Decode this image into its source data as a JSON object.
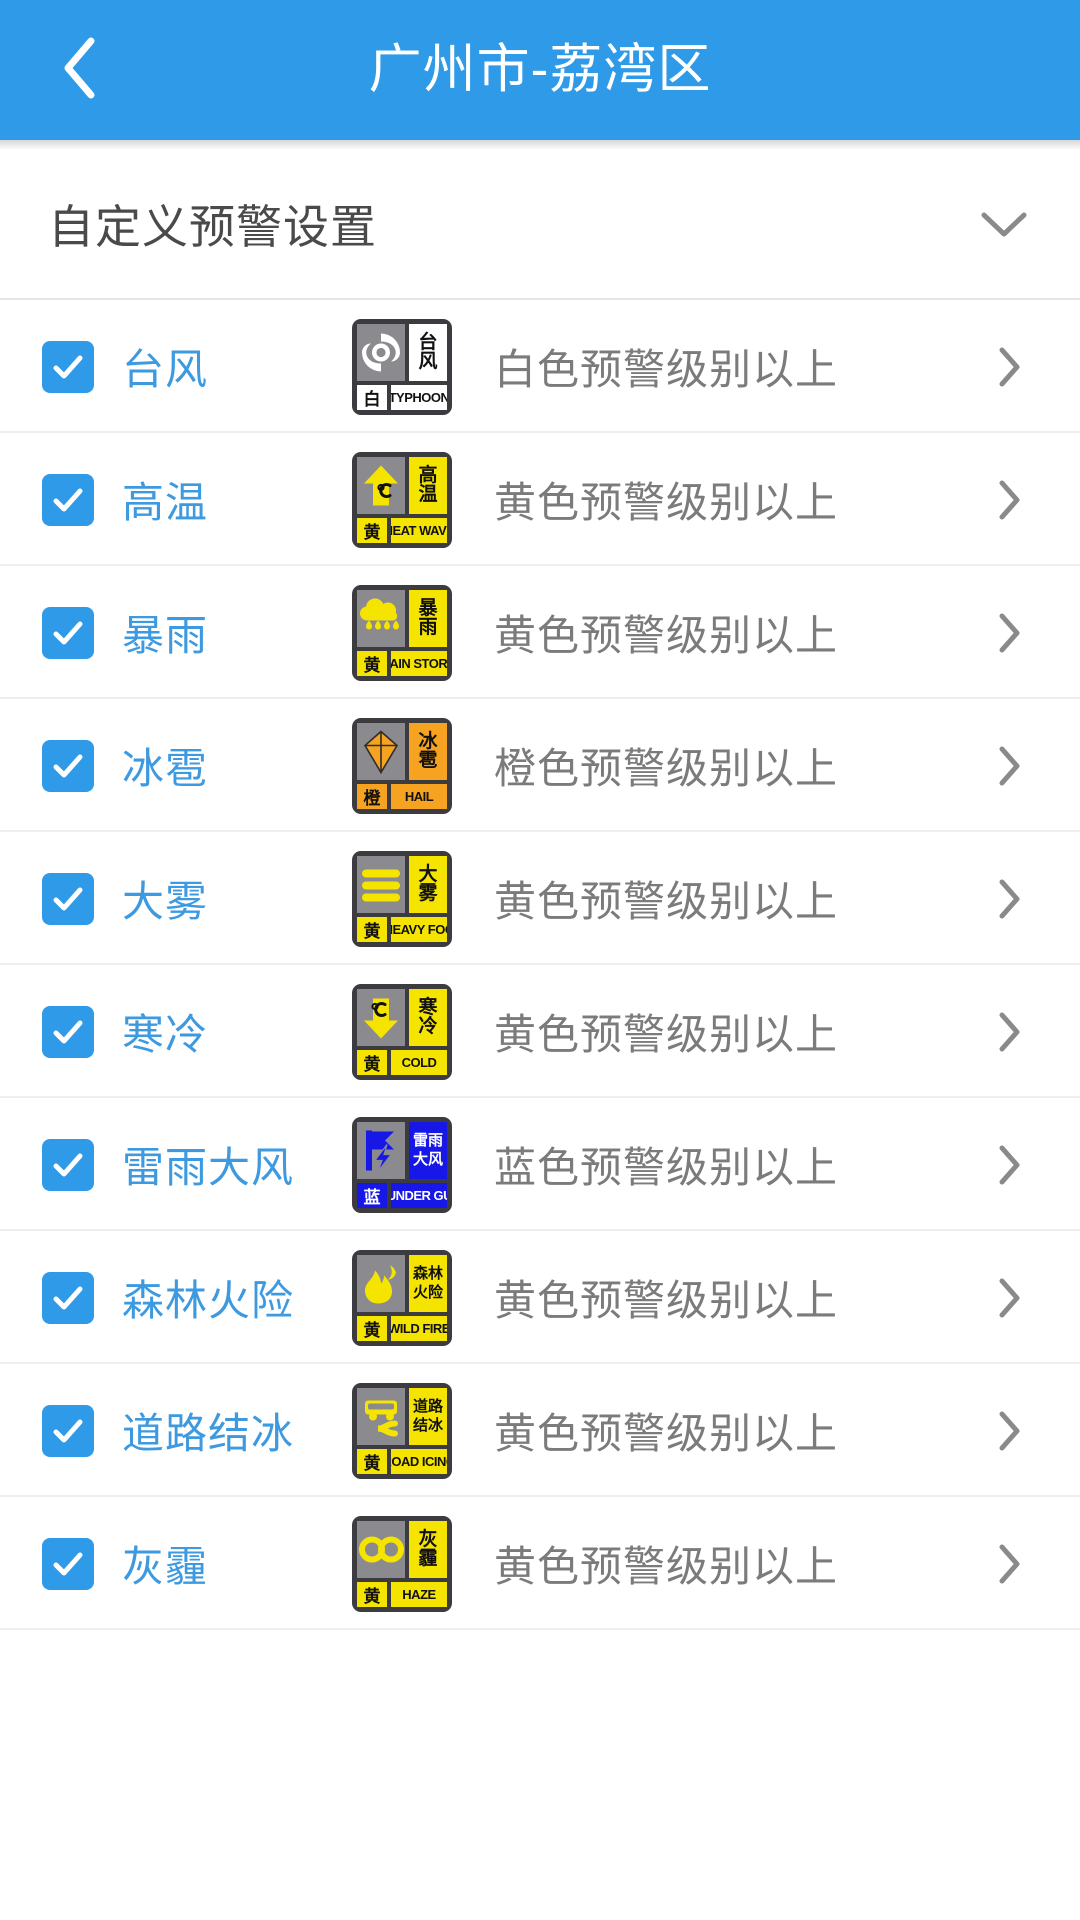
{
  "appbar": {
    "title": "广州市-荔湾区",
    "back_icon": "chevron-left-icon",
    "background_color": "#2e9ae8",
    "title_color": "#ffffff"
  },
  "section": {
    "title": "自定义预警设置",
    "expand_icon": "chevron-down-icon"
  },
  "colors": {
    "accent": "#2e9ae8",
    "label_blue": "#3d9ae0",
    "level_text": "#7b7b7b",
    "white_level": "#ffffff",
    "yellow_level": "#f5e400",
    "orange_level": "#f5a321",
    "blue_level": "#1717e8"
  },
  "rows": [
    {
      "label": "台风",
      "checked": true,
      "level_text": "白色预警级别以上",
      "chevron_icon": "chevron-right-icon",
      "sign": {
        "name_cn": [
          "台",
          "风"
        ],
        "name_en": "TYPHOON",
        "level_cn": "白",
        "color": "white",
        "pictogram": "typhoon-swirl-icon"
      }
    },
    {
      "label": "高温",
      "checked": true,
      "level_text": "黄色预警级别以上",
      "chevron_icon": "chevron-right-icon",
      "sign": {
        "name_cn": [
          "高",
          "温"
        ],
        "name_en": "HEAT WAVE",
        "level_cn": "黄",
        "color": "yellow",
        "pictogram": "up-arrow-celsius-icon"
      }
    },
    {
      "label": "暴雨",
      "checked": true,
      "level_text": "黄色预警级别以上",
      "chevron_icon": "chevron-right-icon",
      "sign": {
        "name_cn": [
          "暴",
          "雨"
        ],
        "name_en": "RAIN STORM",
        "level_cn": "黄",
        "color": "yellow",
        "pictogram": "rain-cloud-icon"
      }
    },
    {
      "label": "冰雹",
      "checked": true,
      "level_text": "橙色预警级别以上",
      "chevron_icon": "chevron-right-icon",
      "sign": {
        "name_cn": [
          "冰",
          "雹"
        ],
        "name_en": "HAIL",
        "level_cn": "橙",
        "color": "orange",
        "pictogram": "hailstone-icon"
      }
    },
    {
      "label": "大雾",
      "checked": true,
      "level_text": "黄色预警级别以上",
      "chevron_icon": "chevron-right-icon",
      "sign": {
        "name_cn": [
          "大",
          "雾"
        ],
        "name_en": "HEAVY FOG",
        "level_cn": "黄",
        "color": "yellow",
        "pictogram": "fog-bars-icon"
      }
    },
    {
      "label": "寒冷",
      "checked": true,
      "level_text": "黄色预警级别以上",
      "chevron_icon": "chevron-right-icon",
      "sign": {
        "name_cn": [
          "寒",
          "冷"
        ],
        "name_en": "COLD",
        "level_cn": "黄",
        "color": "yellow",
        "pictogram": "down-arrow-celsius-icon"
      }
    },
    {
      "label": "雷雨大风",
      "checked": true,
      "level_text": "蓝色预警级别以上",
      "chevron_icon": "chevron-right-icon",
      "sign": {
        "name_cn": [
          "雷雨",
          "大风"
        ],
        "name_en": "THUNDER GUST",
        "level_cn": "蓝",
        "color": "blue",
        "pictogram": "lightning-flag-icon"
      }
    },
    {
      "label": "森林火险",
      "checked": true,
      "level_text": "黄色预警级别以上",
      "chevron_icon": "chevron-right-icon",
      "sign": {
        "name_cn": [
          "森林",
          "火险"
        ],
        "name_en": "WILD FIRE",
        "level_cn": "黄",
        "color": "yellow",
        "pictogram": "flame-icon"
      }
    },
    {
      "label": "道路结冰",
      "checked": true,
      "level_text": "黄色预警级别以上",
      "chevron_icon": "chevron-right-icon",
      "sign": {
        "name_cn": [
          "道路",
          "结冰"
        ],
        "name_en": "ROAD ICING",
        "level_cn": "黄",
        "color": "yellow",
        "pictogram": "skidding-car-icon"
      }
    },
    {
      "label": "灰霾",
      "checked": true,
      "level_text": "黄色预警级别以上",
      "chevron_icon": "chevron-right-icon",
      "sign": {
        "name_cn": [
          "灰",
          "霾"
        ],
        "name_en": "HAZE",
        "level_cn": "黄",
        "color": "yellow",
        "pictogram": "haze-infinity-icon"
      }
    }
  ]
}
